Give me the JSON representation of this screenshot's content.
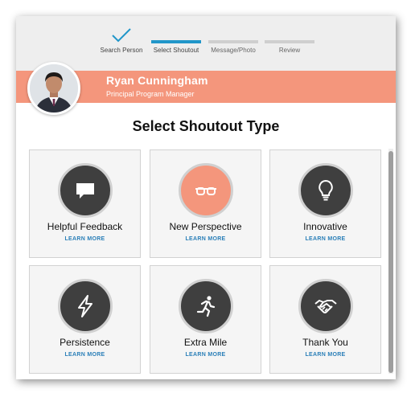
{
  "stepper": {
    "steps": [
      {
        "label": "Search Person",
        "state": "complete"
      },
      {
        "label": "Select Shoutout",
        "state": "active"
      },
      {
        "label": "Message/Photo",
        "state": "pending"
      },
      {
        "label": "Review",
        "state": "pending"
      }
    ]
  },
  "profile": {
    "name": "Ryan Cunningham",
    "role": "Principal Program Manager"
  },
  "heading": "Select Shoutout Type",
  "shoutouts": [
    {
      "title": "Helpful Feedback",
      "link": "LEARN MORE",
      "icon": "speech-bubble-icon",
      "selected": false
    },
    {
      "title": "New Perspective",
      "link": "LEARN MORE",
      "icon": "glasses-icon",
      "selected": true
    },
    {
      "title": "Innovative",
      "link": "LEARN MORE",
      "icon": "lightbulb-icon",
      "selected": false
    },
    {
      "title": "Persistence",
      "link": "LEARN MORE",
      "icon": "lightning-bolt-icon",
      "selected": false
    },
    {
      "title": "Extra Mile",
      "link": "LEARN MORE",
      "icon": "running-person-icon",
      "selected": false
    },
    {
      "title": "Thank You",
      "link": "LEARN MORE",
      "icon": "handshake-icon",
      "selected": false
    }
  ],
  "colors": {
    "accent": "#f4967c",
    "active_step": "#2196c9",
    "link": "#2a7fb8",
    "icon_bg": "#3f3f3f"
  }
}
